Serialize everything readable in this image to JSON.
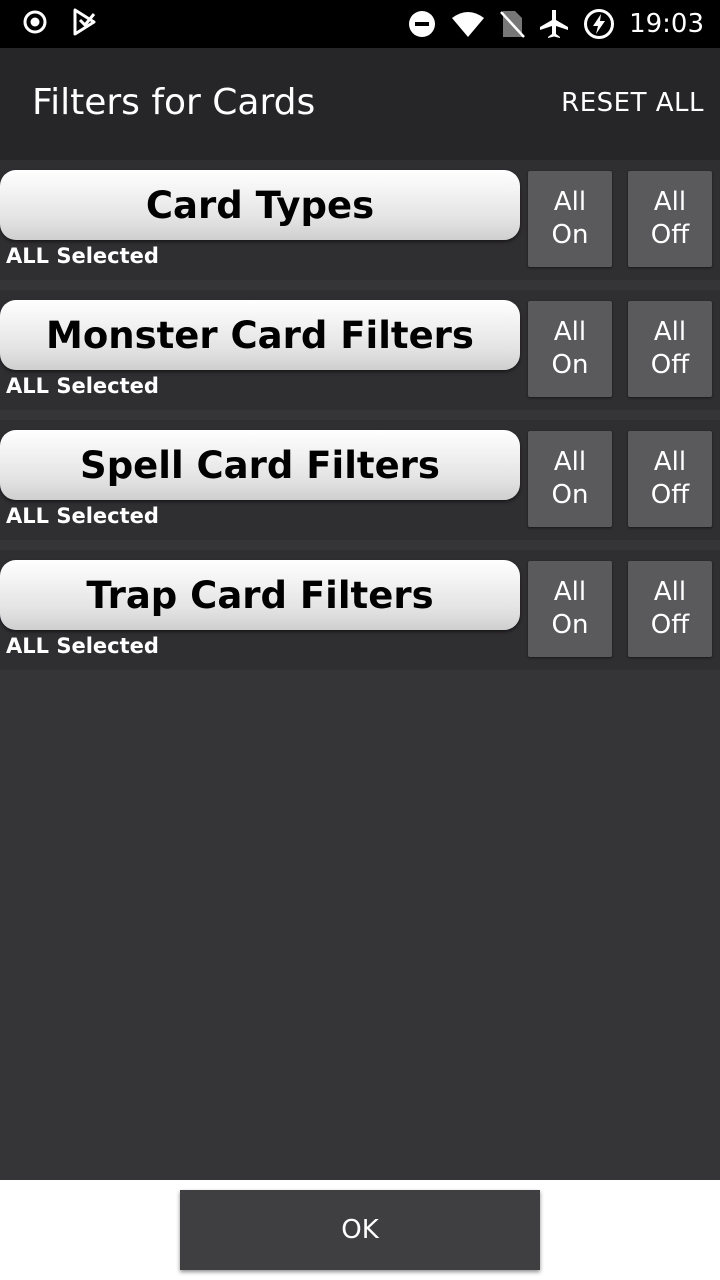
{
  "status_bar": {
    "time": "19:03",
    "icons_left": [
      "record-icon",
      "play-store-icon"
    ],
    "icons_right": [
      "do-not-disturb-icon",
      "wifi-icon",
      "no-sim-icon",
      "airplane-icon",
      "battery-charging-icon"
    ]
  },
  "toolbar": {
    "title": "Filters for Cards",
    "reset_label": "RESET ALL"
  },
  "filters": [
    {
      "label": "Card Types",
      "status": "ALL Selected",
      "on_line1": "All",
      "on_line2": "On",
      "off_line1": "All",
      "off_line2": "Off"
    },
    {
      "label": "Monster Card Filters",
      "status": "ALL Selected",
      "on_line1": "All",
      "on_line2": "On",
      "off_line1": "All",
      "off_line2": "Off"
    },
    {
      "label": "Spell Card Filters",
      "status": "ALL Selected",
      "on_line1": "All",
      "on_line2": "On",
      "off_line1": "All",
      "off_line2": "Off"
    },
    {
      "label": "Trap Card Filters",
      "status": "ALL Selected",
      "on_line1": "All",
      "on_line2": "On",
      "off_line1": "All",
      "off_line2": "Off"
    }
  ],
  "footer": {
    "ok_label": "OK"
  },
  "colors": {
    "background": "#353437",
    "toolbar": "#262528",
    "row": "#2f2e31",
    "toggle": "#5a595c",
    "ok_button": "#3f3e41"
  }
}
